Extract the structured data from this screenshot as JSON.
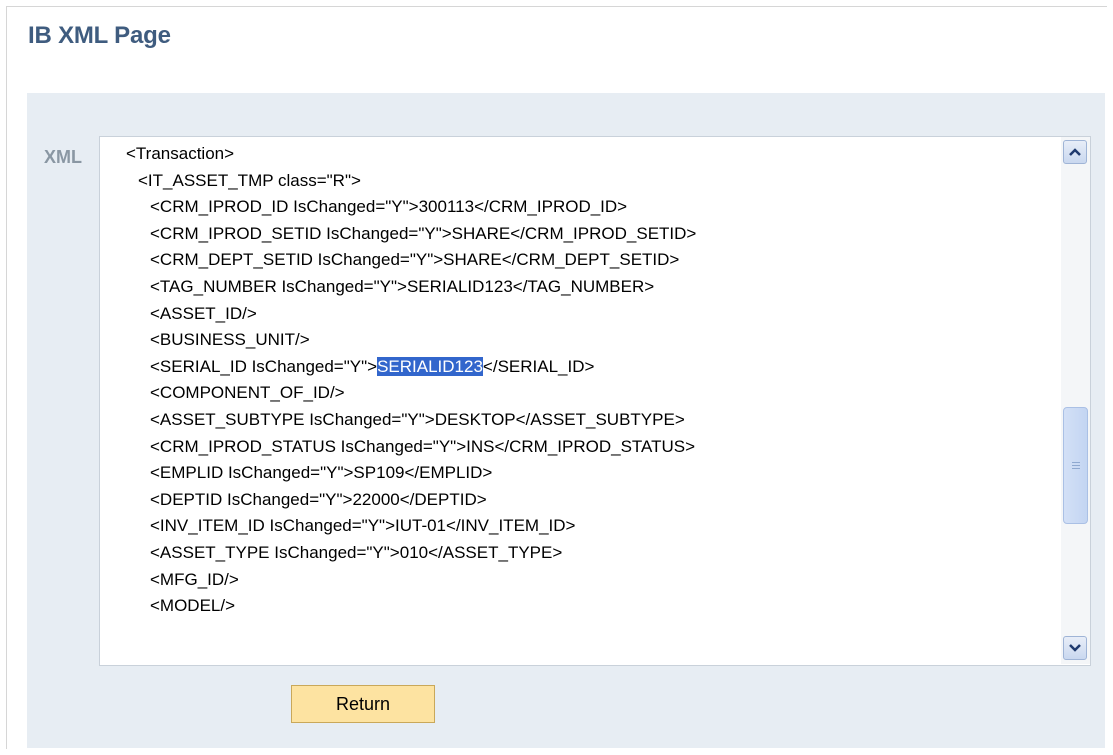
{
  "page": {
    "title": "IB XML Page"
  },
  "xml": {
    "label": "XML",
    "lines": [
      {
        "text": "<Transaction>",
        "indent": 1
      },
      {
        "text": "<IT_ASSET_TMP class=\"R\">",
        "indent": 2
      },
      {
        "text": "<CRM_IPROD_ID IsChanged=\"Y\">300113</CRM_IPROD_ID>",
        "indent": 3
      },
      {
        "text": "<CRM_IPROD_SETID IsChanged=\"Y\">SHARE</CRM_IPROD_SETID>",
        "indent": 3
      },
      {
        "text": "<CRM_DEPT_SETID IsChanged=\"Y\">SHARE</CRM_DEPT_SETID>",
        "indent": 3
      },
      {
        "text": "<TAG_NUMBER IsChanged=\"Y\">SERIALID123</TAG_NUMBER>",
        "indent": 3
      },
      {
        "text": "<ASSET_ID/>",
        "indent": 3
      },
      {
        "text": "<BUSINESS_UNIT/>",
        "indent": 3
      },
      {
        "text": "<SERIAL_ID IsChanged=\"Y\">SERIALID123</SERIAL_ID>",
        "indent": 3,
        "pre": "<SERIAL_ID IsChanged=\"Y\">",
        "selected": "SERIALID123",
        "post": "</SERIAL_ID>"
      },
      {
        "text": "<COMPONENT_OF_ID/>",
        "indent": 3
      },
      {
        "text": "<ASSET_SUBTYPE IsChanged=\"Y\">DESKTOP</ASSET_SUBTYPE>",
        "indent": 3
      },
      {
        "text": "<CRM_IPROD_STATUS IsChanged=\"Y\">INS</CRM_IPROD_STATUS>",
        "indent": 3
      },
      {
        "text": "<EMPLID IsChanged=\"Y\">SP109</EMPLID>",
        "indent": 3
      },
      {
        "text": "<DEPTID IsChanged=\"Y\">22000</DEPTID>",
        "indent": 3
      },
      {
        "text": "<INV_ITEM_ID IsChanged=\"Y\">IUT-01</INV_ITEM_ID>",
        "indent": 3
      },
      {
        "text": "<ASSET_TYPE IsChanged=\"Y\">010</ASSET_TYPE>",
        "indent": 3
      },
      {
        "text": "<MFG_ID/>",
        "indent": 3
      },
      {
        "text": "<MODEL/>",
        "indent": 3
      }
    ],
    "scroll_position": 0.55
  },
  "buttons": {
    "return_label": "Return"
  },
  "icons": {
    "scroll_up": "chevron-up-icon",
    "scroll_down": "chevron-down-icon"
  },
  "colors": {
    "title": "#3f5c7f",
    "panel": "#e7edf3",
    "selection": "#3266cc",
    "button": "#fde3a1"
  }
}
